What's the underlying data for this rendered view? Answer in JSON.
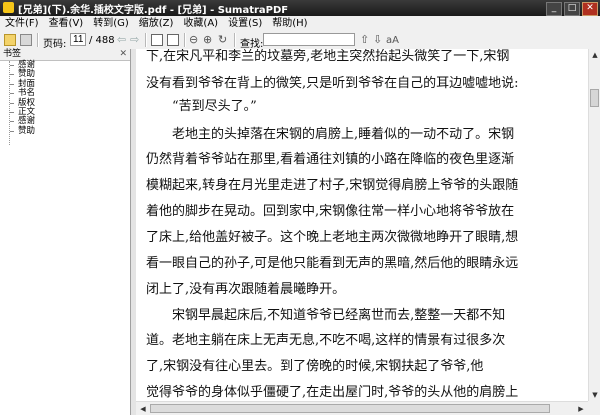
{
  "window": {
    "title": "[兄弟](下).余华.插校文字版.pdf - [兄弟] - SumatraPDF"
  },
  "menu": [
    "文件(F)",
    "查看(V)",
    "转到(G)",
    "缩放(Z)",
    "收藏(A)",
    "设置(S)",
    "帮助(H)"
  ],
  "toolbar": {
    "page_label": "页码:",
    "page_value": "11",
    "page_total": "/ 488",
    "search_label": "查找:",
    "search_value": ""
  },
  "sidebar": {
    "title": "书签",
    "close": "✕",
    "items": [
      "感谢",
      "赞助",
      "封面",
      "书名",
      "版权",
      "正文",
      "感谢",
      "赞助"
    ]
  },
  "document": {
    "lines": [
      "下,在宋凡平和李兰的坟墓旁,老地主突然抬起头微笑了一下,宋钢",
      "没有看到爷爷在背上的微笑,只是听到爷爷在自己的耳边嘘嘘地说:",
      "“苦到尽头了。”",
      "老地主的头掉落在宋钢的肩膀上,睡着似的一动不动了。宋钢",
      "仍然背着爷爷站在那里,看着通往刘镇的小路在降临的夜色里逐渐",
      "模糊起来,转身在月光里走进了村子,宋钢觉得肩膀上爷爷的头跟随",
      "着他的脚步在晃动。回到家中,宋钢像往常一样小心地将爷爷放在",
      "了床上,给他盖好被子。这个晚上老地主两次微微地睁开了眼睛,想",
      "看一眼自己的孙子,可是他只能看到无声的黑暗,然后他的眼睛永远",
      "闭上了,没有再次跟随着晨曦睁开。",
      "宋钢早晨起床后,不知道爷爷已经离世而去,整整一天都不知",
      "道。老地主躺在床上无声无息,不吃不喝,这样的情景有过很多次",
      "了,宋钢没有往心里去。到了傍晚的时候,宋钢扶起了爷爷,他",
      "觉得爷爷的身体似乎僵硬了,在走出屋门时,爷爷的头从他的肩膀上"
    ]
  }
}
